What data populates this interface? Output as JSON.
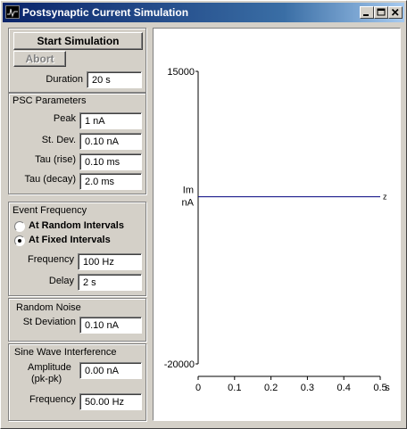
{
  "window": {
    "title": "Postsynaptic Current Simulation"
  },
  "controls": {
    "start_label": "Start Simulation",
    "abort_label": "Abort",
    "duration_label": "Duration",
    "duration_value": "20 s"
  },
  "psc": {
    "title": "PSC Parameters",
    "peak_label": "Peak",
    "peak_value": "1 nA",
    "stdev_label": "St. Dev.",
    "stdev_value": "0.10 nA",
    "rise_label": "Tau (rise)",
    "rise_value": "0.10 ms",
    "decay_label": "Tau (decay)",
    "decay_value": "2.0 ms"
  },
  "event": {
    "title": "Event Frequency",
    "random_label": "At Random Intervals",
    "fixed_label": "At Fixed Intervals",
    "selected": "fixed",
    "frequency_label": "Frequency",
    "frequency_value": "100 Hz",
    "delay_label": "Delay",
    "delay_value": "2 s"
  },
  "noise": {
    "title": "Random Noise",
    "stdev_label": "St Deviation",
    "stdev_value": "0.10 nA"
  },
  "sine": {
    "title": "Sine Wave Interference",
    "amplitude_label": "Amplitude",
    "amplitude_label2": "(pk-pk)",
    "amplitude_value": "0.00 nA",
    "frequency_label": "Frequency",
    "frequency_value": "50.00 Hz"
  },
  "chart_data": {
    "type": "line",
    "ylabel_1": "Im",
    "ylabel_2": "nA",
    "ylim": [
      -20000,
      15000
    ],
    "yticks": [
      15000,
      -20000
    ],
    "xlim": [
      0,
      0.5
    ],
    "xticks": [
      "0",
      "0.1",
      "0.2",
      "0.3",
      "0.4",
      "0.5"
    ],
    "xunit": "s",
    "trace_end_label": "z",
    "series": [
      {
        "x": [
          0,
          0.5
        ],
        "y": [
          0,
          0
        ],
        "color": "#00007f"
      }
    ]
  }
}
